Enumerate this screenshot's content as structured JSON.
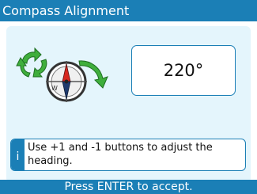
{
  "title": "Compass Alignment",
  "heading_value": "220°",
  "info": {
    "marker": "i",
    "text": "Use +1 and -1 buttons to adjust the heading."
  },
  "footer": "Press ENTER to accept.",
  "icons": [
    "rotate-arrows-icon",
    "compass-icon",
    "rotate-arrow-icon"
  ],
  "colors": {
    "accent": "#1b7fb6",
    "panel": "#e4f5fc",
    "arrow_green": "#3fae3c",
    "needle_red": "#d7261e"
  }
}
